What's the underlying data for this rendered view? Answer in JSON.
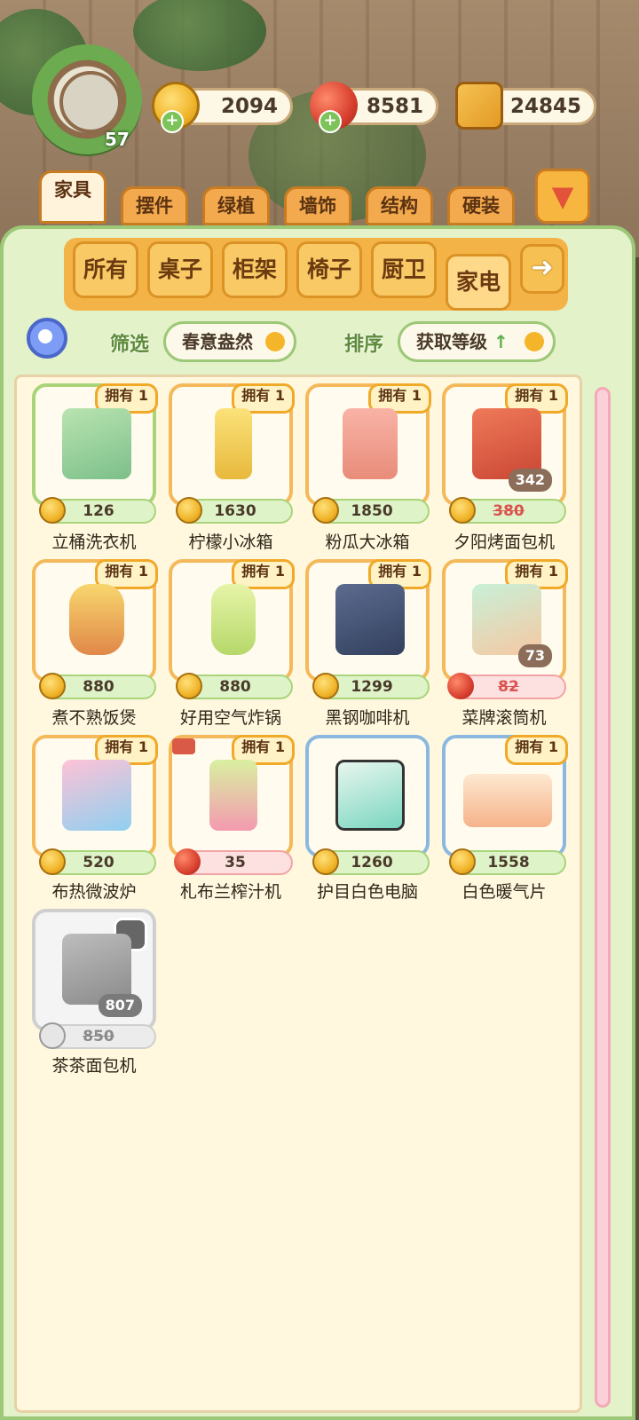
{
  "header": {
    "level": "57",
    "currencies": [
      {
        "name": "coin",
        "value": "2094"
      },
      {
        "name": "cherry",
        "value": "8581"
      },
      {
        "name": "book",
        "value": "24845"
      }
    ]
  },
  "category_tabs": [
    "家具",
    "摆件",
    "绿植",
    "墙饰",
    "结构",
    "硬装"
  ],
  "sub_tabs": [
    "所有",
    "桌子",
    "柜架",
    "椅子",
    "厨卫",
    "家电"
  ],
  "filter": {
    "label": "筛选",
    "value": "春意盎然"
  },
  "sort": {
    "label": "排序",
    "value": "获取等级"
  },
  "owned_label": "拥有 1",
  "items": [
    {
      "name": "立桶洗衣机",
      "price": "126",
      "owned": true,
      "border": "green"
    },
    {
      "name": "柠檬小冰箱",
      "price": "1630",
      "owned": true,
      "border": "orange"
    },
    {
      "name": "粉瓜大冰箱",
      "price": "1850",
      "owned": true,
      "border": "orange"
    },
    {
      "name": "夕阳烤面包机",
      "price": "380",
      "discount": "342",
      "owned": true,
      "border": "orange"
    },
    {
      "name": "煮不熟饭煲",
      "price": "880",
      "owned": true,
      "border": "orange"
    },
    {
      "name": "好用空气炸锅",
      "price": "880",
      "owned": true,
      "border": "orange"
    },
    {
      "name": "黑钢咖啡机",
      "price": "1299",
      "owned": true,
      "border": "orange"
    },
    {
      "name": "菜牌滚筒机",
      "price": "82",
      "discount": "73",
      "owned": true,
      "border": "orange",
      "currency": "cherry"
    },
    {
      "name": "布热微波炉",
      "price": "520",
      "owned": true,
      "border": "orange"
    },
    {
      "name": "札布兰榨汁机",
      "price": "35",
      "owned": true,
      "border": "orange",
      "currency": "cherry"
    },
    {
      "name": "护目白色电脑",
      "price": "1260",
      "owned": false,
      "border": "blue"
    },
    {
      "name": "白色暖气片",
      "price": "1558",
      "owned": true,
      "border": "blue"
    },
    {
      "name": "茶茶面包机",
      "price": "850",
      "discount": "807",
      "owned": false,
      "border": "gray",
      "locked": true
    }
  ]
}
